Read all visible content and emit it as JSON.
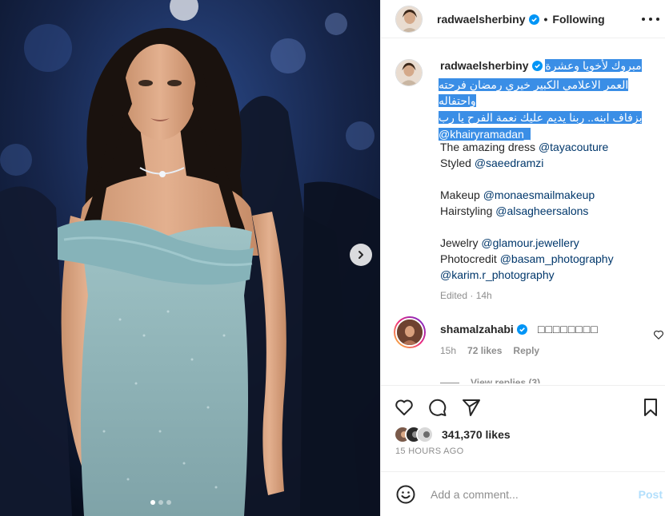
{
  "header": {
    "username": "radwaelsherbiny",
    "separator": "•",
    "follow_status": "Following"
  },
  "caption": {
    "username": "radwaelsherbiny",
    "arabic_first": "مبروك لأخويا وعشرة",
    "arabic_lines": [
      "العمر الاعلامي الكبير خيري رمضان فرحته واحتفاله",
      "بزفاف ابنه.. ربنا يديم عليك نعمة الفرح يا رب",
      "@khairyramadan_"
    ],
    "lines": [
      {
        "text": "The amazing dress ",
        "mention": "@tayacouture"
      },
      {
        "text": "Styled ",
        "mention": "@saeedramzi"
      },
      {
        "text": "Makeup ",
        "mention": "@monaesmailmakeup"
      },
      {
        "text": "Hairstyling ",
        "mention": "@alsagheersalons"
      },
      {
        "text": "Jewelry ",
        "mention": "@glamour.jewellery"
      },
      {
        "text": "Photocredit ",
        "mention": "@basam_photography"
      },
      {
        "text": "",
        "mention": "@karim.r_photography"
      }
    ],
    "meta": "Edited · 14h"
  },
  "comment": {
    "username": "shamalzahabi",
    "text": "□□□□□□□□",
    "time": "15h",
    "likes": "72 likes",
    "reply": "Reply",
    "view_replies": "View replies (3)"
  },
  "likes": {
    "count": "341,370",
    "label": "likes"
  },
  "time_ago": "15 HOURS AGO",
  "add_comment": {
    "placeholder": "Add a comment...",
    "post_label": "Post"
  },
  "colors": {
    "link": "#00376b",
    "selection": "#3a8ee6",
    "post_disabled": "#b2dffc",
    "verified": "#0095f6"
  }
}
